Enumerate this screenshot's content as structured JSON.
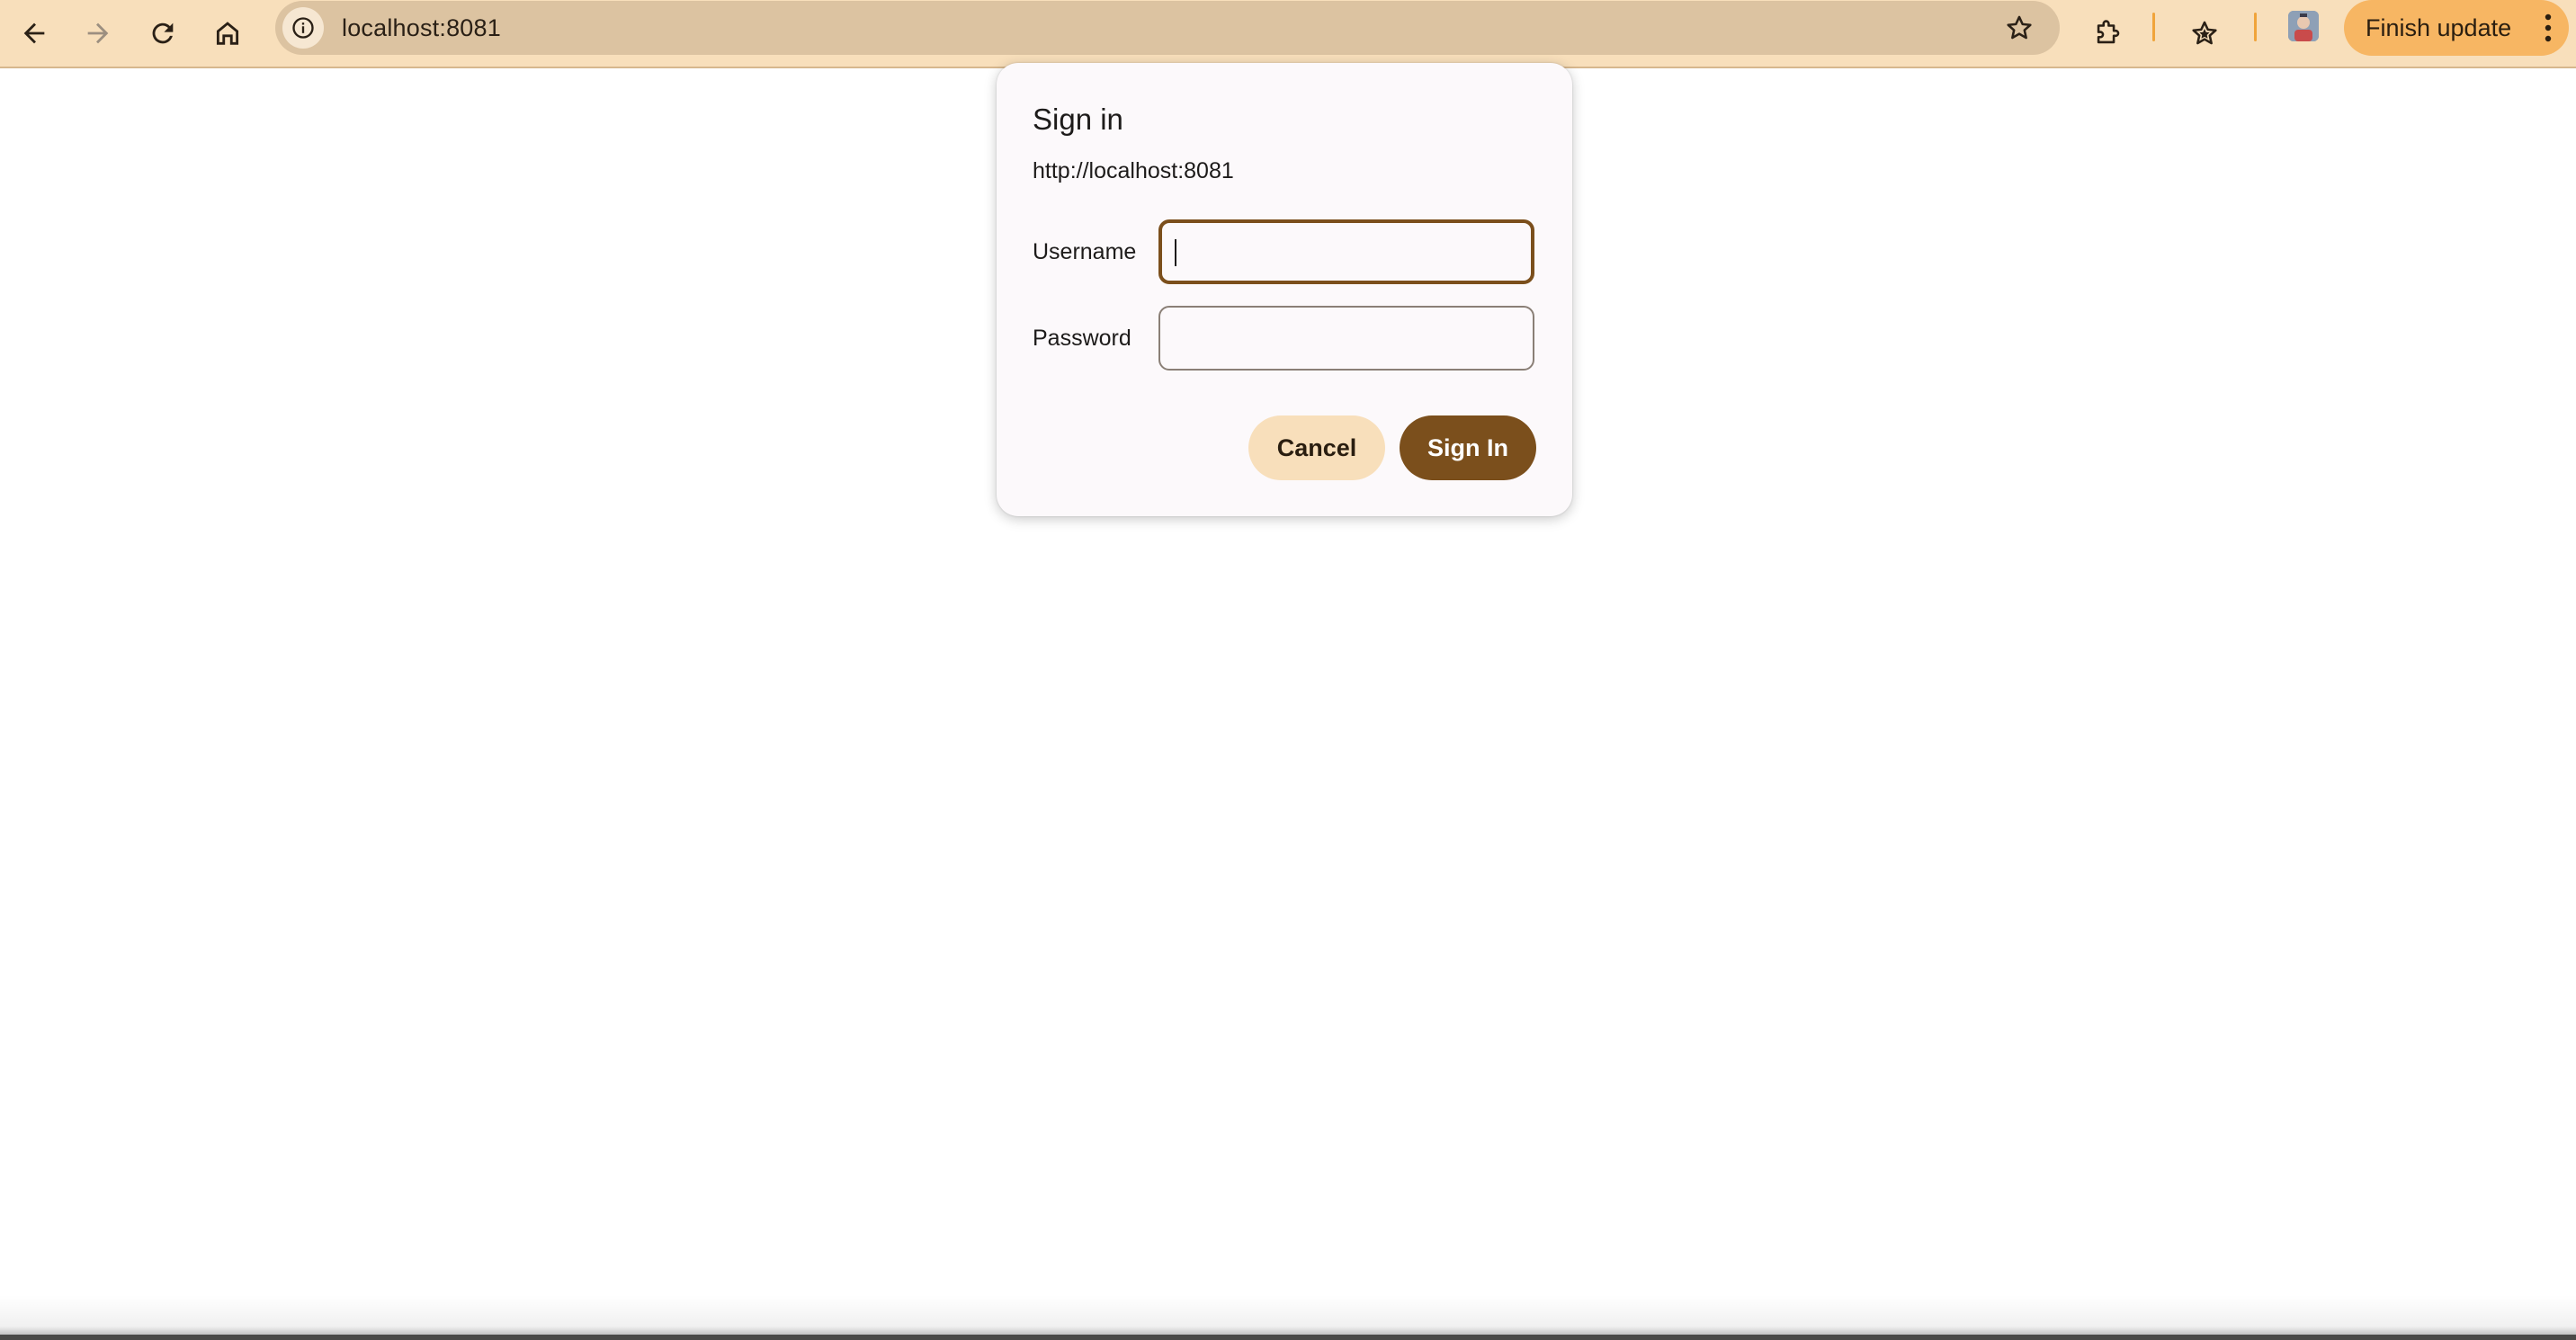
{
  "browser": {
    "url": "localhost:8081",
    "update_label": "Finish update",
    "colors": {
      "toolbar": "#f8dfbb",
      "omnibox": "#dcc3a1",
      "update_pill": "#f7b663",
      "separator": "#f0a43b"
    }
  },
  "dialog": {
    "title": "Sign in",
    "origin": "http://localhost:8081",
    "username_label": "Username",
    "username_value": "",
    "password_label": "Password",
    "password_value": "",
    "cancel_label": "Cancel",
    "signin_label": "Sign In",
    "colors": {
      "primary": "#7b4f1c",
      "secondary": "#f8dfbb",
      "surface": "#fcf9fb"
    }
  }
}
